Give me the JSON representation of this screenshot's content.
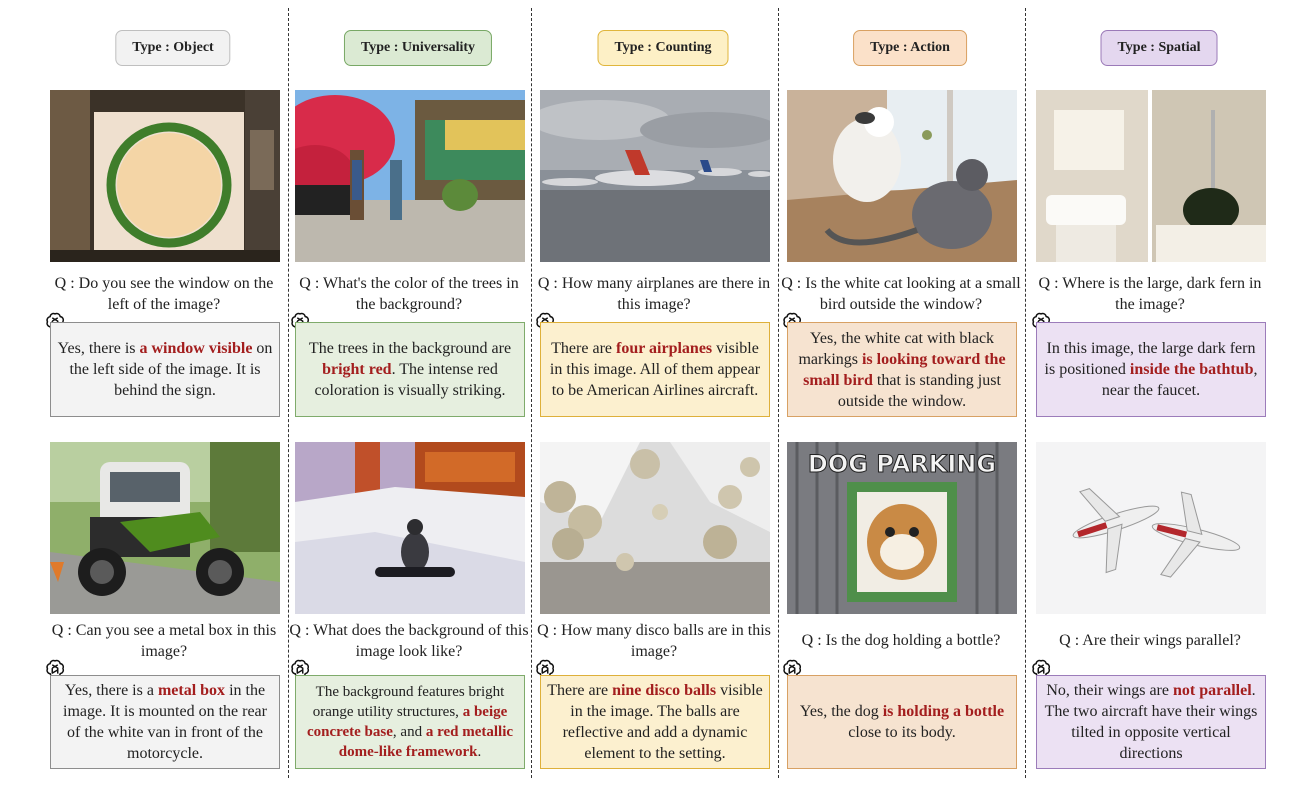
{
  "columns": [
    {
      "type_label": "Type : Object",
      "panels": [
        {
          "question": "Q : Do you see the window on the left of the image?",
          "answer": [
            {
              "t": "Yes, there is ",
              "h": false
            },
            {
              "t": "a window visible",
              "h": true
            },
            {
              "t": " on the left side of the image. It is behind the sign.",
              "h": false
            }
          ]
        },
        {
          "question": "Q : Can you see a metal box in this image?",
          "answer": [
            {
              "t": "Yes, there is a ",
              "h": false
            },
            {
              "t": "metal box",
              "h": true
            },
            {
              "t": " in the image. It is mounted on the rear of the white van in front of the motorcycle.",
              "h": false
            }
          ]
        }
      ]
    },
    {
      "type_label": "Type : Universality",
      "panels": [
        {
          "question": "Q : What's the color of the trees in the background?",
          "answer": [
            {
              "t": "The trees in the background are ",
              "h": false
            },
            {
              "t": "bright red",
              "h": true
            },
            {
              "t": ". The intense red coloration is visually striking.",
              "h": false
            }
          ]
        },
        {
          "question": "Q : What does the background of this image look like?",
          "answer": [
            {
              "t": "The background features bright orange utility structures, ",
              "h": false
            },
            {
              "t": "a beige concrete base",
              "h": true
            },
            {
              "t": ", and ",
              "h": false
            },
            {
              "t": "a red metallic dome-like framework",
              "h": true
            },
            {
              "t": ".",
              "h": false
            }
          ]
        }
      ]
    },
    {
      "type_label": "Type : Counting",
      "panels": [
        {
          "question": "Q : How many airplanes are there in this image?",
          "answer": [
            {
              "t": "There are ",
              "h": false
            },
            {
              "t": "four airplanes",
              "h": true
            },
            {
              "t": " visible in this image. All of them appear to be American Airlines aircraft.",
              "h": false
            }
          ]
        },
        {
          "question": "Q : How many disco balls are in this image?",
          "answer": [
            {
              "t": "There are ",
              "h": false
            },
            {
              "t": "nine disco balls",
              "h": true
            },
            {
              "t": " visible in the image. The balls are reflective and add a dynamic element to the setting.",
              "h": false
            }
          ]
        }
      ]
    },
    {
      "type_label": "Type : Action",
      "panels": [
        {
          "question": "Q : Is the white cat looking at a small bird outside the window?",
          "answer": [
            {
              "t": "Yes, the white cat with black markings ",
              "h": false
            },
            {
              "t": "is looking toward the small bird",
              "h": true
            },
            {
              "t": " that is standing just outside the window.",
              "h": false
            }
          ]
        },
        {
          "question": "Q : Is the dog holding a bottle?",
          "answer": [
            {
              "t": "Yes, the dog ",
              "h": false
            },
            {
              "t": "is holding a bottle",
              "h": true
            },
            {
              "t": " close to its body.",
              "h": false
            }
          ]
        }
      ]
    },
    {
      "type_label": "Type : Spatial",
      "panels": [
        {
          "question": "Q : Where is the large, dark fern in the image?",
          "answer": [
            {
              "t": "In this image, the large dark fern is positioned ",
              "h": false
            },
            {
              "t": "inside the bathtub",
              "h": true
            },
            {
              "t": ", near the faucet.",
              "h": false
            }
          ]
        },
        {
          "question": "Q : Are their wings parallel?",
          "answer": [
            {
              "t": "No, their wings are ",
              "h": false
            },
            {
              "t": "not parallel",
              "h": true
            },
            {
              "t": ". The two aircraft have their wings tilted in opposite vertical directions",
              "h": false
            }
          ]
        }
      ]
    }
  ],
  "icons": {
    "assistant": "openai-logo-icon"
  },
  "colors": {
    "highlight": "#a31e1e"
  }
}
